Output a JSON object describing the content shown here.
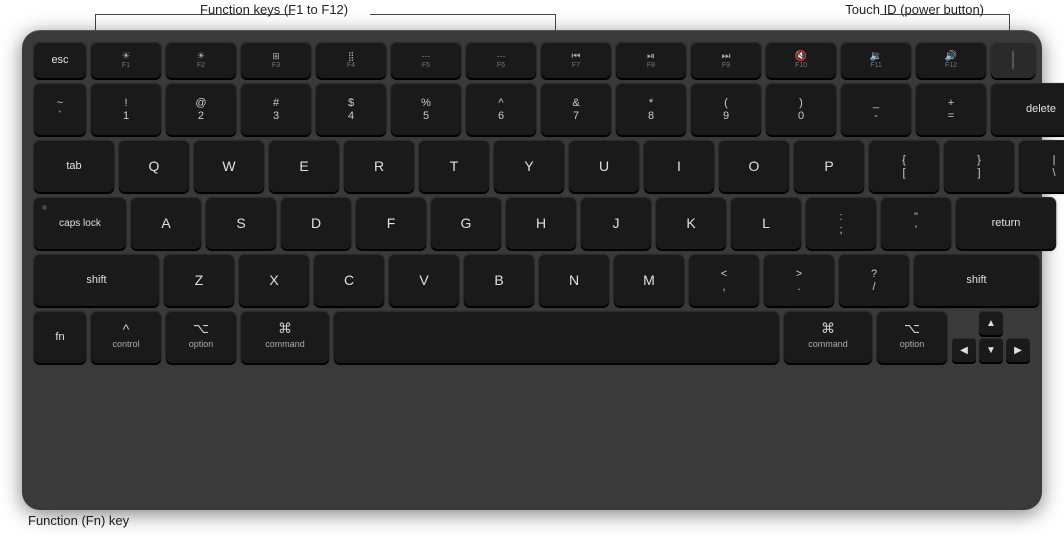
{
  "annotations": {
    "function_keys_label": "Function keys (F1 to F12)",
    "touch_id_label": "Touch ID (power button)",
    "fn_key_label": "Function (Fn) key"
  },
  "keyboard": {
    "rows": {
      "fn_row": [
        "esc",
        "F1",
        "F2",
        "F3",
        "F4",
        "F5",
        "F6",
        "F7",
        "F8",
        "F9",
        "F10",
        "F11",
        "F12",
        "TouchID"
      ],
      "num_row": [
        "~`",
        "!1",
        "@2",
        "#3",
        "$4",
        "%5",
        "^6",
        "&7",
        "*8",
        "(9",
        ")0",
        "-",
        "=+",
        "delete"
      ],
      "tab_row": [
        "tab",
        "Q",
        "W",
        "E",
        "R",
        "T",
        "Y",
        "U",
        "I",
        "O",
        "P",
        "{[",
        "}]",
        "|\\"
      ],
      "caps_row": [
        "caps lock",
        "A",
        "S",
        "D",
        "F",
        "G",
        "H",
        "J",
        "K",
        "L",
        ";:",
        "\"'",
        "return"
      ],
      "shift_row": [
        "shift",
        "Z",
        "X",
        "C",
        "V",
        "B",
        "N",
        "M",
        "<,",
        ">.",
        "?/",
        "shift"
      ],
      "bottom_row": [
        "fn",
        "control",
        "option",
        "command",
        "space",
        "command",
        "option",
        "◀",
        "▲▼",
        "▶"
      ]
    }
  }
}
